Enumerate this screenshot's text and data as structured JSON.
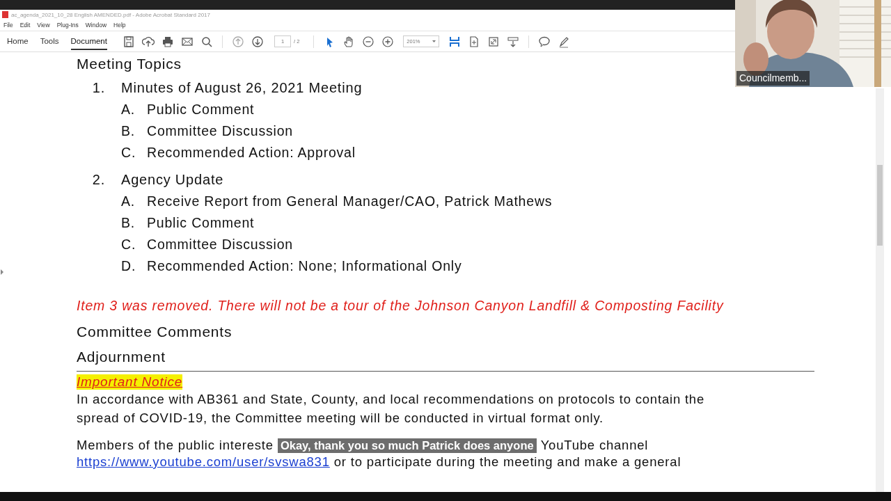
{
  "window": {
    "title": "ac_agenda_2021_10_28 English AMENDED.pdf - Adobe Acrobat Standard 2017"
  },
  "menu": [
    "File",
    "Edit",
    "View",
    "Plug-Ins",
    "Window",
    "Help"
  ],
  "tabs": [
    {
      "label": "Home",
      "selected": false
    },
    {
      "label": "Tools",
      "selected": false
    },
    {
      "label": "Document",
      "selected": true
    }
  ],
  "toolbar": {
    "page": "1",
    "page_total": "/ 2",
    "zoom": "201%"
  },
  "document": {
    "heading": "Meeting Topics",
    "items": [
      {
        "number": "1.",
        "title": "Minutes of August 26, 2021 Meeting",
        "subitems": [
          {
            "letter": "A.",
            "text": "Public Comment"
          },
          {
            "letter": "B.",
            "text": "Committee Discussion"
          },
          {
            "letter": "C.",
            "text": "Recommended Action: Approval"
          }
        ]
      },
      {
        "number": "2.",
        "title": "Agency Update",
        "subitems": [
          {
            "letter": "A.",
            "text": "Receive Report from General Manager/CAO, Patrick Mathews"
          },
          {
            "letter": "B.",
            "text": "Public Comment"
          },
          {
            "letter": "C.",
            "text": "Committee Discussion"
          },
          {
            "letter": "D.",
            "text": "Recommended Action: None; Informational Only"
          }
        ]
      }
    ],
    "removed_notice": "Item 3 was removed. There will not be a tour of the Johnson Canyon Landfill & Composting Facility",
    "sections": [
      "Committee Comments",
      "Adjournment"
    ],
    "important_notice": "Important Notice",
    "paragraph": [
      "In accordance with AB361 and State, County, and local recommendations on protocols to contain the",
      "spread of COVID-19, the Committee meeting will be conducted in virtual format only."
    ],
    "members_line": {
      "before": "Members of the public intereste",
      "after": "YouTube channel"
    },
    "link": "https://www.youtube.com/user/svswa831",
    "link_after": " or to participate during the meeting and make a general"
  },
  "caption": "Okay, thank you so much Patrick does anyone",
  "video": {
    "name": "Councilmemb..."
  }
}
